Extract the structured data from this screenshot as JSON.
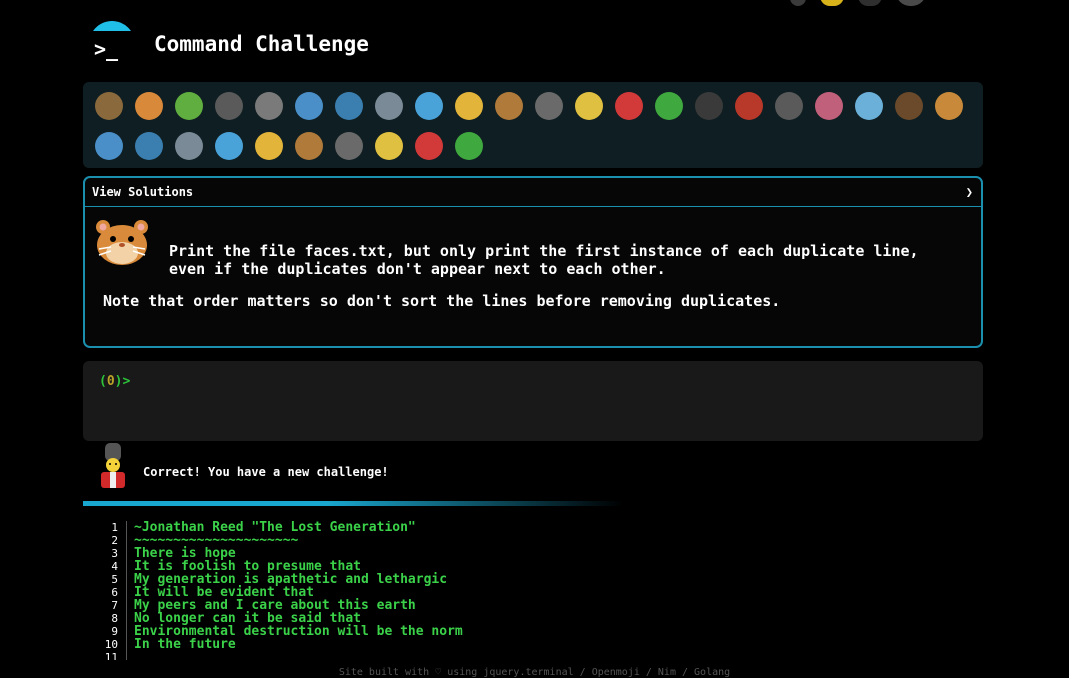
{
  "header": {
    "logo_prompt": ">_",
    "title": "Command Challenge"
  },
  "animals": {
    "row1": [
      "snail",
      "butterfly",
      "caterpillar",
      "ant",
      "spider-web",
      "whale",
      "shark",
      "dolphin",
      "fish",
      "tropical-fish",
      "blowfish",
      "wolf",
      "bee",
      "ladybug",
      "lizard",
      "spider",
      "scorpion",
      "fly",
      "worm",
      "bacteria",
      "monkey",
      "dog"
    ],
    "row2": [
      "fox",
      "cat",
      "lion",
      "tiger",
      "horse",
      "unicorn",
      "cow",
      "pig",
      "mouse",
      "hamster"
    ],
    "colors": [
      "#8a6a3c",
      "#d9893a",
      "#5fae3f",
      "#5a5a5a",
      "#7a7a7a",
      "#4a8fc7",
      "#3a7fb0",
      "#7a8a96",
      "#4aa3d8",
      "#e3b43a",
      "#b07a3a",
      "#6a6a6a",
      "#e0c040",
      "#d23a3a",
      "#3fa83f",
      "#3a3a3a",
      "#b8382a",
      "#5a5a5a",
      "#c0607a",
      "#6ab0d8",
      "#6a4a2a",
      "#c88a3a"
    ]
  },
  "panel": {
    "toggle_label": "View Solutions",
    "toggle_icon": "❯",
    "instruction": "Print the file faces.txt, but only print the first instance of each duplicate line, even if the duplicates don't appear next to each other.",
    "note": "Note that order matters so don't sort the lines before removing duplicates."
  },
  "terminal": {
    "prompt_open": "(",
    "prompt_num": "0",
    "prompt_close": ")>"
  },
  "status": {
    "message": "Correct! You have a new challenge!"
  },
  "code_lines": [
    {
      "n": "1",
      "t": "~Jonathan Reed \"The Lost Generation\""
    },
    {
      "n": "2",
      "t": "~~~~~~~~~~~~~~~~~~~~~"
    },
    {
      "n": "3",
      "t": "There is hope"
    },
    {
      "n": "4",
      "t": "It is foolish to presume that"
    },
    {
      "n": "5",
      "t": "My generation is apathetic and lethargic"
    },
    {
      "n": "6",
      "t": "It will be evident that"
    },
    {
      "n": "7",
      "t": "My peers and I care about this earth"
    },
    {
      "n": "8",
      "t": "No longer can it be said that"
    },
    {
      "n": "9",
      "t": "Environmental destruction will be the norm"
    },
    {
      "n": "10",
      "t": "In the future"
    },
    {
      "n": "11",
      "t": ""
    }
  ],
  "footer": {
    "text": "Site built with ♡ using jquery.terminal / Openmoji / Nim / Golang"
  }
}
